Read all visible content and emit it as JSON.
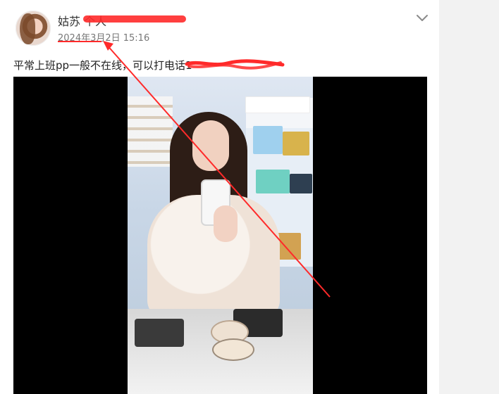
{
  "post": {
    "user_name": "姑苏 个人",
    "time": "2024年3月2日 15:16",
    "text": "平常上班pp一般不在线，可以打电话1"
  },
  "icons": {
    "menu": "chevron-down-icon"
  },
  "colors": {
    "redaction": "#ff2a2a",
    "gutter": "#f2f2f2"
  }
}
